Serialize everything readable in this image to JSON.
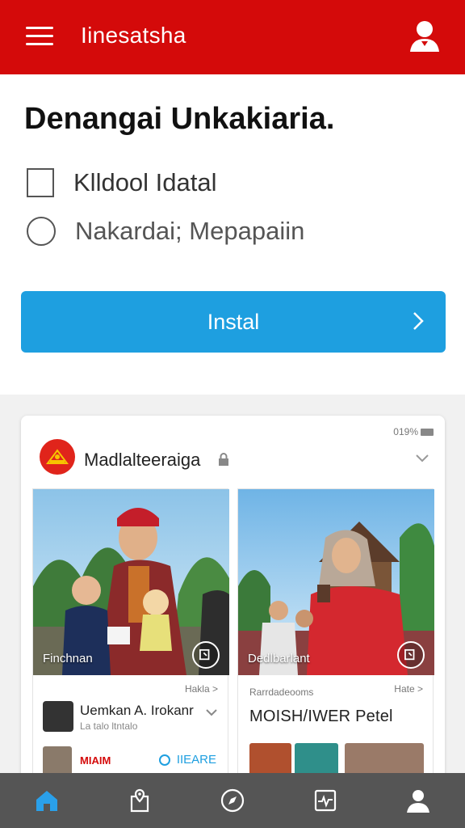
{
  "header": {
    "title": "Iinesatsha",
    "menu_icon": "hamburger-menu-icon",
    "profile_icon": "user-icon"
  },
  "form": {
    "headline": "Denangai Unkakiaria.",
    "checkbox_label": "Klldool Idatal",
    "radio_label": "Nakardai; Mepapaiin",
    "install_label": "Instal"
  },
  "card": {
    "battery": "019%",
    "page_name": "Madlalteeraiga",
    "posts": [
      {
        "photo_caption": "Finchnan",
        "meta_right": "Hakla >",
        "poster_name": "Uemkan A. Irokanr",
        "poster_sub": "La talo ltntalo",
        "tag": "MIAIM",
        "more_label": "IIEARE"
      },
      {
        "photo_caption": "Dedlbarlant",
        "meta_left": "Rarrdadeooms",
        "meta_right": "Hate >",
        "headline": "MOISH/IWER Petel"
      }
    ]
  },
  "bottom_nav": [
    {
      "name": "home",
      "icon": "home-icon",
      "active": true
    },
    {
      "name": "map",
      "icon": "map-pin-icon",
      "active": false
    },
    {
      "name": "explore",
      "icon": "compass-icon",
      "active": false
    },
    {
      "name": "activity",
      "icon": "activity-icon",
      "active": false
    },
    {
      "name": "profile",
      "icon": "user-icon",
      "active": false
    }
  ],
  "colors": {
    "brand_red": "#d40a0a",
    "accent_blue": "#1e9fe0",
    "nav_bg": "#555555"
  }
}
